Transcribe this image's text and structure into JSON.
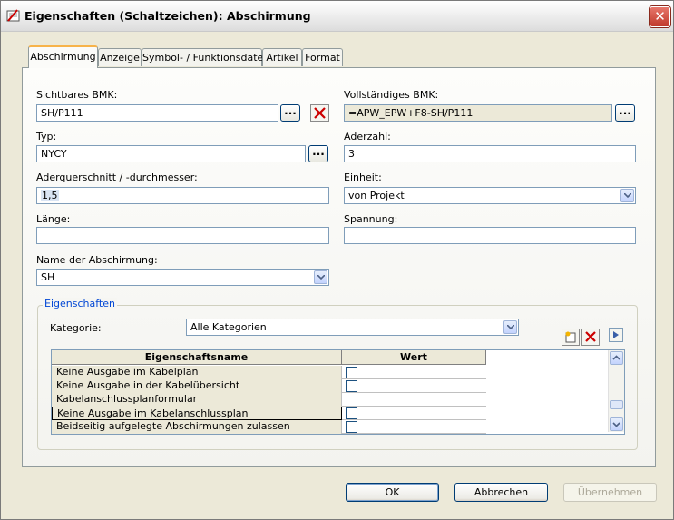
{
  "window": {
    "title": "Eigenschaften (Schaltzeichen): Abschirmung",
    "close_label": "✕"
  },
  "tabs": [
    {
      "label": "Abschirmung"
    },
    {
      "label": "Anzeige"
    },
    {
      "label": "Symbol- / Funktionsdaten"
    },
    {
      "label": "Artikel"
    },
    {
      "label": "Format"
    }
  ],
  "form": {
    "sichtbares_bmk": {
      "label": "Sichtbares BMK:",
      "value": "SH/P111"
    },
    "vollstaendiges_bmk": {
      "label": "Vollständiges BMK:",
      "value": "=APW_EPW+F8-SH/P111"
    },
    "typ": {
      "label": "Typ:",
      "value": "NYCY"
    },
    "aderzahl": {
      "label": "Aderzahl:",
      "value": "3"
    },
    "aderquerschnitt": {
      "label": "Aderquerschnitt / -durchmesser:",
      "value": "1,5"
    },
    "einheit": {
      "label": "Einheit:",
      "value": "von Projekt"
    },
    "laenge": {
      "label": "Länge:",
      "value": ""
    },
    "spannung": {
      "label": "Spannung:",
      "value": ""
    },
    "name_abschirmung": {
      "label": "Name der Abschirmung:",
      "value": "SH"
    },
    "browse_label": "..."
  },
  "eigenschaften": {
    "group_title": "Eigenschaften",
    "kategorie_label": "Kategorie:",
    "kategorie_value": "Alle Kategorien",
    "columns": [
      "Eigenschaftsname",
      "Wert"
    ],
    "rows": [
      {
        "name": "Keine Ausgabe im Kabelplan",
        "checkbox": true
      },
      {
        "name": "Keine Ausgabe in der Kabelübersicht",
        "checkbox": true
      },
      {
        "name": "Kabelanschlussplanformular",
        "checkbox": false
      },
      {
        "name": "Keine Ausgabe im  Kabelanschlussplan",
        "checkbox": true
      },
      {
        "name": "Beidseitig aufgelegte Abschirmungen zulassen",
        "checkbox": true
      }
    ]
  },
  "buttons": {
    "ok": "OK",
    "cancel": "Abbrechen",
    "apply": "Übernehmen"
  },
  "colors": {
    "accent_tab": "#f7b34a",
    "group_title": "#0046d5",
    "delete_red": "#cc0000"
  }
}
